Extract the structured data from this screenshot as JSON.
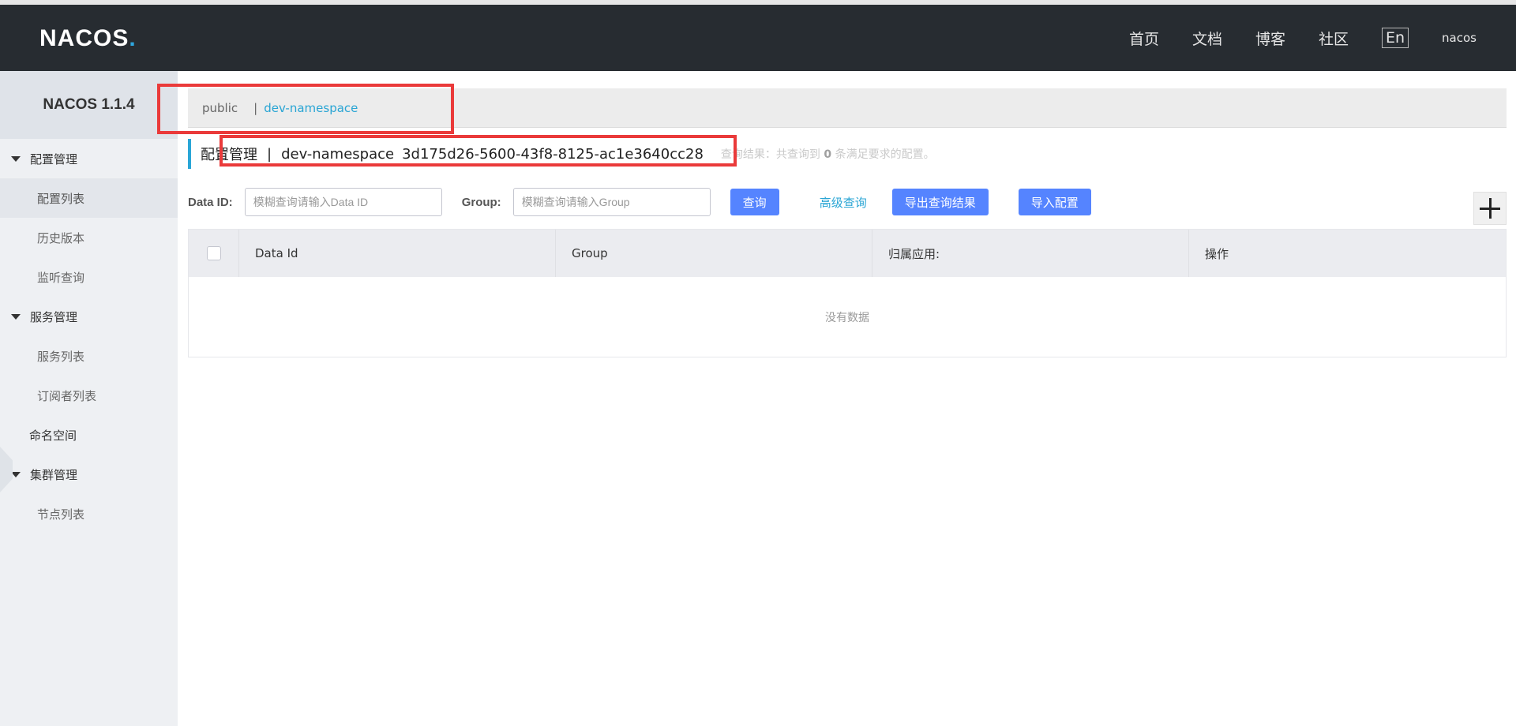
{
  "header": {
    "logo_main": "NACOS",
    "logo_suffix": ".",
    "nav": [
      "首页",
      "文档",
      "博客",
      "社区"
    ],
    "lang": "En",
    "user": "nacos"
  },
  "sidebar": {
    "version": "NACOS 1.1.4",
    "groups": [
      {
        "label": "配置管理",
        "items": [
          "配置列表",
          "历史版本",
          "监听查询"
        ]
      },
      {
        "label": "服务管理",
        "items": [
          "服务列表",
          "订阅者列表"
        ]
      },
      {
        "label": "命名空间"
      },
      {
        "label": "集群管理",
        "items": [
          "节点列表"
        ]
      }
    ]
  },
  "namespace_bar": {
    "public": "public",
    "separator": "|",
    "active": "dev-namespace"
  },
  "title": {
    "text": "配置管理",
    "separator": "|",
    "namespace": "dev-namespace",
    "namespace_id": "3d175d26-5600-43f8-8125-ac1e3640cc28",
    "result_prefix": "查询结果：共查询到",
    "result_count": "0",
    "result_suffix": "条满足要求的配置。"
  },
  "search": {
    "data_id_label": "Data ID:",
    "data_id_placeholder": "模糊查询请输入Data ID",
    "group_label": "Group:",
    "group_placeholder": "模糊查询请输入Group",
    "query_button": "查询",
    "advanced_link": "高级查询",
    "export_button": "导出查询结果",
    "import_button": "导入配置"
  },
  "table": {
    "columns": [
      "Data Id",
      "Group",
      "归属应用:",
      "操作"
    ],
    "empty_text": "没有数据"
  },
  "colors": {
    "header_bg": "#272c31",
    "primary": "#5584ff",
    "link": "#29a5d4",
    "highlight": "#ea3a3a"
  }
}
